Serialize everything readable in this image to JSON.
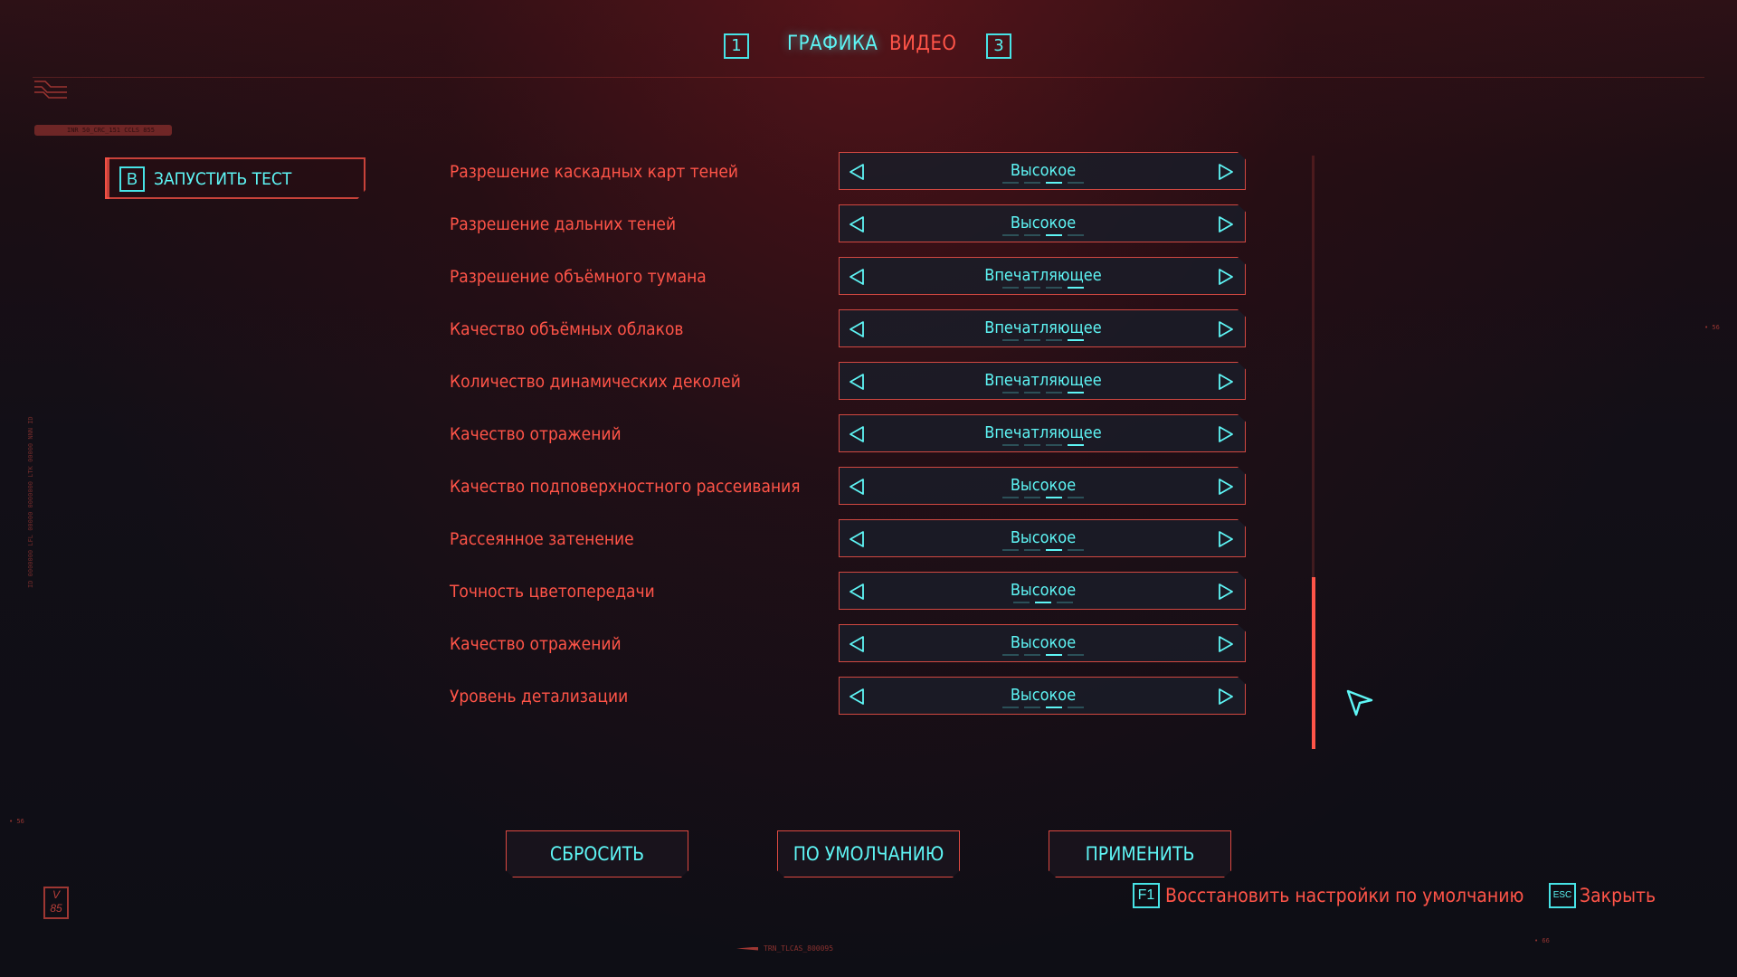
{
  "tabs": {
    "prev_key": "1",
    "active": "ГРАФИКА",
    "next": "ВИДЕО",
    "next_key": "3"
  },
  "benchmark": {
    "key": "B",
    "label": "ЗАПУСТИТЬ ТЕСТ"
  },
  "settings": [
    {
      "label": "Разрешение каскадных карт теней",
      "value": "Высокое",
      "level": 3,
      "steps": 4
    },
    {
      "label": "Разрешение дальних теней",
      "value": "Высокое",
      "level": 3,
      "steps": 4
    },
    {
      "label": "Разрешение объёмного тумана",
      "value": "Впечатляющее",
      "level": 4,
      "steps": 4
    },
    {
      "label": "Качество объёмных облаков",
      "value": "Впечатляющее",
      "level": 4,
      "steps": 4
    },
    {
      "label": "Количество динамических деколей",
      "value": "Впечатляющее",
      "level": 4,
      "steps": 4
    },
    {
      "label": "Качество отражений",
      "value": "Впечатляющее",
      "level": 4,
      "steps": 4
    },
    {
      "label": "Качество подповерхностного рассеивания",
      "value": "Высокое",
      "level": 3,
      "steps": 4
    },
    {
      "label": "Рассеянное затенение",
      "value": "Высокое",
      "level": 3,
      "steps": 4
    },
    {
      "label": "Точность цветопередачи",
      "value": "Высокое",
      "level": 2,
      "steps": 3
    },
    {
      "label": "Качество отражений",
      "value": "Высокое",
      "level": 3,
      "steps": 4
    },
    {
      "label": "Уровень детализации",
      "value": "Высокое",
      "level": 3,
      "steps": 4
    }
  ],
  "scroll": {
    "thumb_start": 0.71,
    "thumb_fraction": 0.29
  },
  "actions": {
    "reset": "СБРОСИТЬ",
    "default": "ПО УМОЛЧАНИЮ",
    "apply": "ПРИМЕНИТЬ"
  },
  "hints": {
    "restore_key": "F1",
    "restore_label": "Восстановить настройки по умолчанию",
    "close_key": "ESC",
    "close_label": "Закрыть"
  },
  "decor": {
    "version_badge": "V 85",
    "bottom_code": "TRN_TLCAS_800095",
    "bar_code": "INR 50_CRC_151 CCLS 855"
  },
  "colors": {
    "accent_red": "#ff5448",
    "accent_cyan": "#5ef5f5",
    "background": "#0e0e15"
  }
}
